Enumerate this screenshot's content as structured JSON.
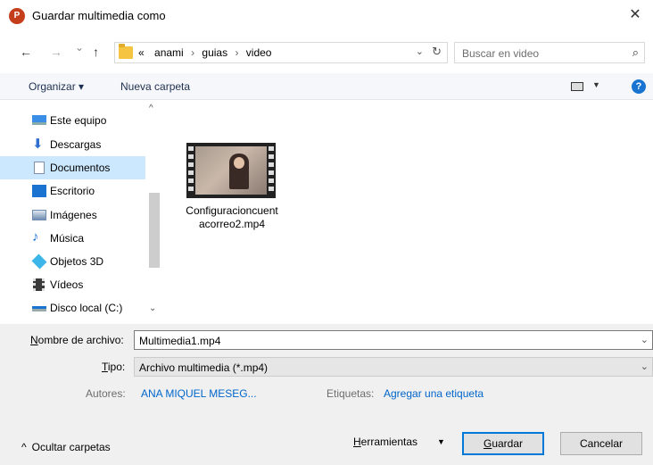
{
  "window": {
    "app_icon_letter": "P",
    "title": "Guardar multimedia como",
    "close_glyph": "✕"
  },
  "nav": {
    "back_glyph": "←",
    "forward_glyph": "→",
    "recent_glyph": "⌄",
    "up_glyph": "↑",
    "breadcrumb_prefix": "«",
    "breadcrumbs": [
      "anami",
      "guias",
      "video"
    ],
    "crumb_sep": "›",
    "address_drop_glyph": "⌄",
    "refresh_glyph": "↻",
    "search_placeholder": "Buscar en video",
    "search_glyph": "⌕"
  },
  "toolbar": {
    "organize_label": "Organizar ▾",
    "new_folder_label": "Nueva carpeta",
    "view_drop_glyph": "▼",
    "help_glyph": "?"
  },
  "sidebar": {
    "items": [
      {
        "label": "Este equipo",
        "icon": "computer-icon",
        "color": "#3a8ee6"
      },
      {
        "label": "Descargas",
        "icon": "download-icon",
        "color": "#2f6fcf"
      },
      {
        "label": "Documentos",
        "icon": "document-icon",
        "color": "#7f8fa6",
        "selected": true
      },
      {
        "label": "Escritorio",
        "icon": "desktop-icon",
        "color": "#1a73d1"
      },
      {
        "label": "Imágenes",
        "icon": "image-icon",
        "color": "#6f8db0"
      },
      {
        "label": "Música",
        "icon": "music-icon",
        "color": "#1a73d1"
      },
      {
        "label": "Objetos 3D",
        "icon": "cube-icon",
        "color": "#3cb6e8"
      },
      {
        "label": "Vídeos",
        "icon": "film-icon",
        "color": "#3a3a3a"
      },
      {
        "label": "Disco local (C:)",
        "icon": "drive-icon",
        "color": "#1a73d1"
      }
    ],
    "scroll_up_glyph": "^",
    "scroll_down_glyph": "⌄"
  },
  "files": [
    {
      "name": "Configuracioncuentacorreo2.mp4",
      "icon": "video-thumbnail-icon"
    }
  ],
  "form": {
    "filename_label_u": "N",
    "filename_label_rest": "ombre de archivo:",
    "filename_value": "Multimedia1.mp4",
    "type_label_u": "T",
    "type_label_rest": "ipo:",
    "type_value": "Archivo multimedia (*.mp4)",
    "drop_glyph": "⌄",
    "authors_label": "Autores:",
    "authors_value": "ANA MIQUEL MESEG...",
    "tags_label": "Etiquetas:",
    "tags_value": "Agregar una etiqueta"
  },
  "footer": {
    "hide_folders_glyph": "^",
    "hide_folders_label": "Ocultar carpetas",
    "tools_label_u": "H",
    "tools_label_rest": "erramientas",
    "tools_drop_glyph": "▼",
    "save_label_u": "G",
    "save_label_rest": "uardar",
    "cancel_label": "Cancelar"
  },
  "colors": {
    "accent": "#0078d7",
    "link": "#0066cc",
    "selected": "#cce8ff"
  }
}
